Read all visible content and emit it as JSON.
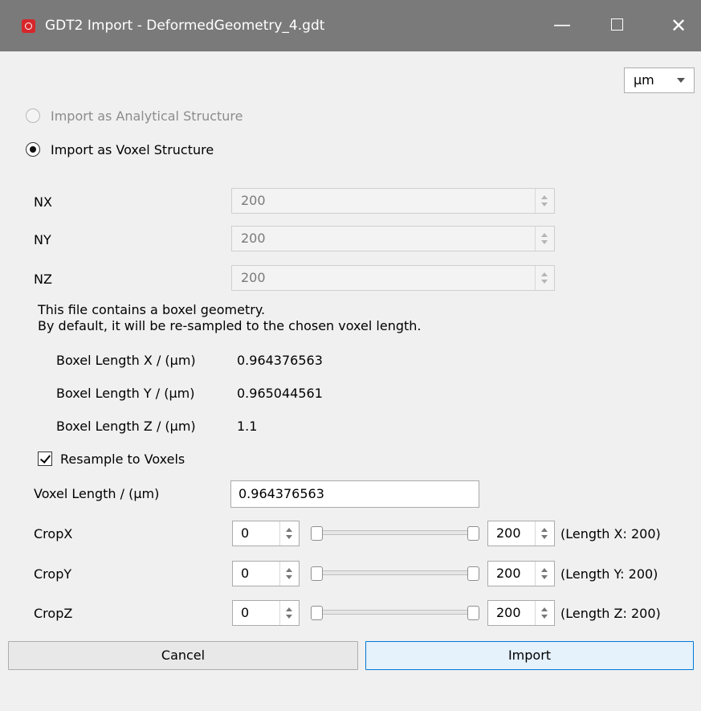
{
  "window": {
    "title": "GDT2 Import - DeformedGeometry_4.gdt",
    "minimize_symbol": "—",
    "close_symbol": "✕",
    "icon": "app-logo-icon"
  },
  "unit_select": {
    "value": "µm"
  },
  "import_mode": {
    "analytical_label": "Import as Analytical Structure",
    "voxel_label": "Import as Voxel Structure",
    "selected": "voxel"
  },
  "grid": [
    {
      "label": "NX",
      "value": "200"
    },
    {
      "label": "NY",
      "value": "200"
    },
    {
      "label": "NZ",
      "value": "200"
    }
  ],
  "info": {
    "line1": "This file contains a boxel geometry.",
    "line2": "By default, it will be re-sampled to the chosen voxel length."
  },
  "boxel": [
    {
      "label": "Boxel Length X / (µm)",
      "value": "0.964376563"
    },
    {
      "label": "Boxel Length Y / (µm)",
      "value": "0.965044561"
    },
    {
      "label": "Boxel Length Z / (µm)",
      "value": "1.1"
    }
  ],
  "resample": {
    "label": "Resample to Voxels",
    "checked": true
  },
  "voxel_length": {
    "label": "Voxel Length / (µm)",
    "value": "0.964376563"
  },
  "crop": [
    {
      "label": "CropX",
      "min": "0",
      "max": "200",
      "length_text": "(Length X: 200)"
    },
    {
      "label": "CropY",
      "min": "0",
      "max": "200",
      "length_text": "(Length Y: 200)"
    },
    {
      "label": "CropZ",
      "min": "0",
      "max": "200",
      "length_text": "(Length Z: 200)"
    }
  ],
  "buttons": {
    "cancel": "Cancel",
    "import": "Import"
  },
  "colors": {
    "titlebar": "#7a7a7a",
    "accent": "#0078d7",
    "app_icon": "#d7262b"
  }
}
